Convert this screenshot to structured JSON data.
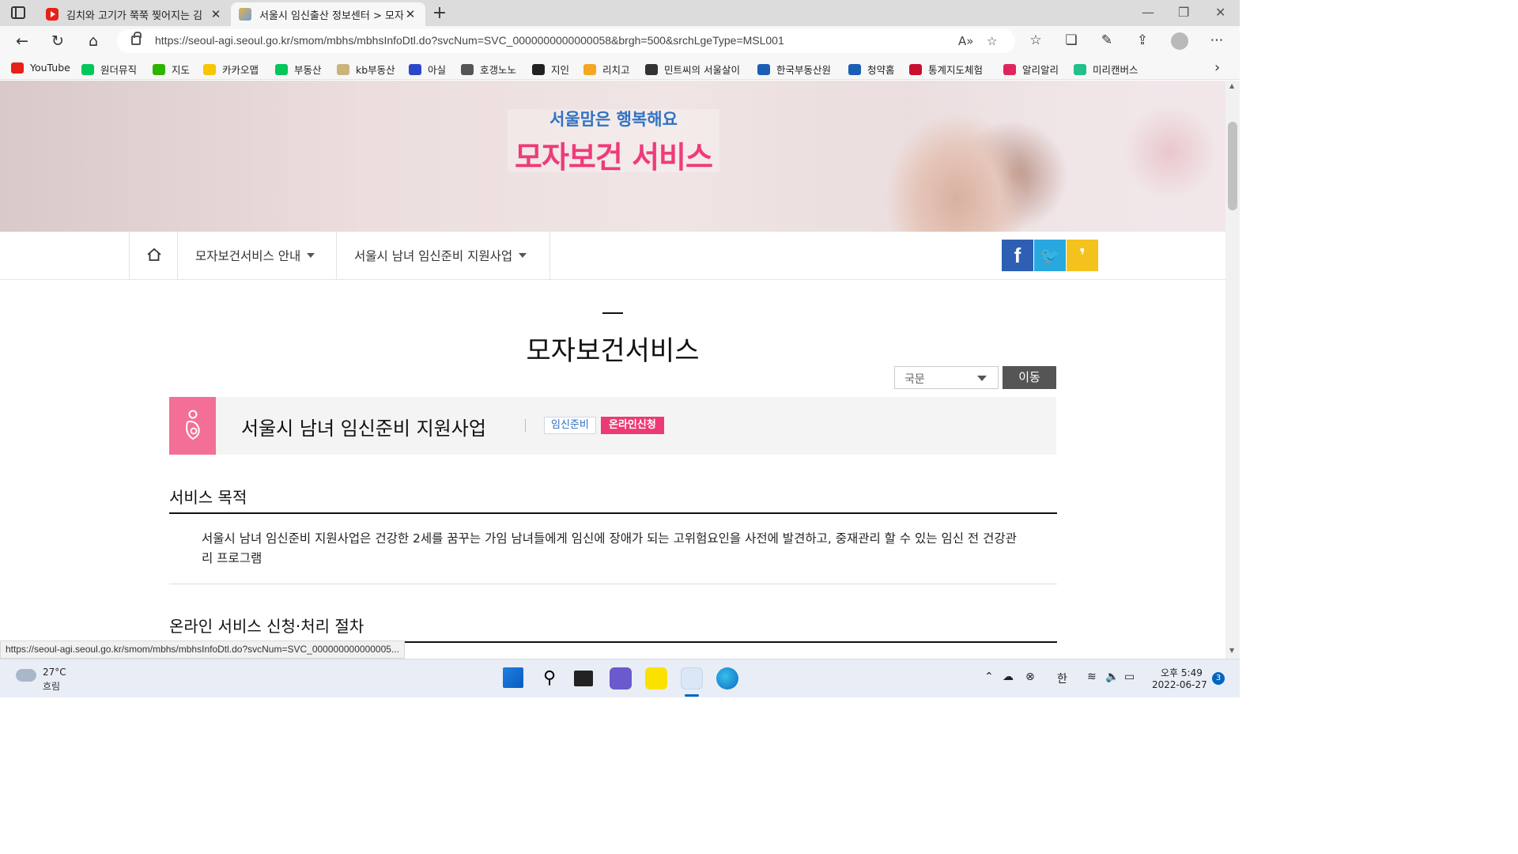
{
  "browser": {
    "tabs": [
      {
        "title": "김치와 고기가 쭉쭉 찢어지는 김",
        "active": false
      },
      {
        "title": "서울시 임신출산 정보센터 > 모자",
        "active": true
      }
    ],
    "url": "https://seoul-agi.seoul.go.kr/smom/mbhs/mbhsInfoDtl.do?svcNum=SVC_0000000000000058&brgh=500&srchLgeType=MSL001",
    "bookmarks": [
      {
        "label": "YouTube",
        "color": "#e62117"
      },
      {
        "label": "원더뮤직",
        "color": "#03c75a"
      },
      {
        "label": "지도",
        "color": "#2db400"
      },
      {
        "label": "카카오맵",
        "color": "#f7c600"
      },
      {
        "label": "부동산",
        "color": "#03c75a"
      },
      {
        "label": "kb부동산",
        "color": "#c9b47a"
      },
      {
        "label": "아실",
        "color": "#2b48c8"
      },
      {
        "label": "호갱노노",
        "color": "#555555"
      },
      {
        "label": "지인",
        "color": "#222222"
      },
      {
        "label": "리치고",
        "color": "#f5a623"
      },
      {
        "label": "민트씨의 서울살이",
        "color": "#333333"
      },
      {
        "label": "한국부동산원",
        "color": "#1a5fb4"
      },
      {
        "label": "청약홈",
        "color": "#1a5fb4"
      },
      {
        "label": "통계지도체험",
        "color": "#c8102e"
      },
      {
        "label": "알리알리",
        "color": "#e0245e"
      },
      {
        "label": "미리캔버스",
        "color": "#22c08a"
      }
    ],
    "status_link": "https://seoul-agi.seoul.go.kr/smom/mbhs/mbhsInfoDtl.do?svcNum=SVC_000000000000005..."
  },
  "hero": {
    "subtitle": "서울맘은 행복해요",
    "title": "모자보건 서비스"
  },
  "subnav": {
    "items": [
      "모자보건서비스 안내",
      "서울시 남녀 임신준비 지원사업"
    ]
  },
  "share": {
    "facebook": "f",
    "twitter": "🐦",
    "kakaostory": "❜"
  },
  "page": {
    "title": "모자보건서비스",
    "language_select": "국문",
    "go_button": "이동",
    "service": {
      "name": "서울시 남녀 임신준비 지원사업",
      "tags": [
        "임신준비",
        "온라인신청"
      ]
    },
    "sections": [
      {
        "title": "서비스 목적",
        "body": "서울시 남녀 임신준비 지원사업은 건강한 2세를 꿈꾸는 가임 남녀들에게 임신에 장애가 되는 고위험요인을 사전에 발견하고, 중재관리 할 수 있는 임신 전 건강관리 프로그램"
      },
      {
        "title": "온라인 서비스 신청·처리 절차"
      }
    ]
  },
  "taskbar": {
    "weather_temp": "27°C",
    "weather_desc": "흐림",
    "ime": "한",
    "time": "오후 5:49",
    "date": "2022-06-27",
    "notifications": "3"
  }
}
